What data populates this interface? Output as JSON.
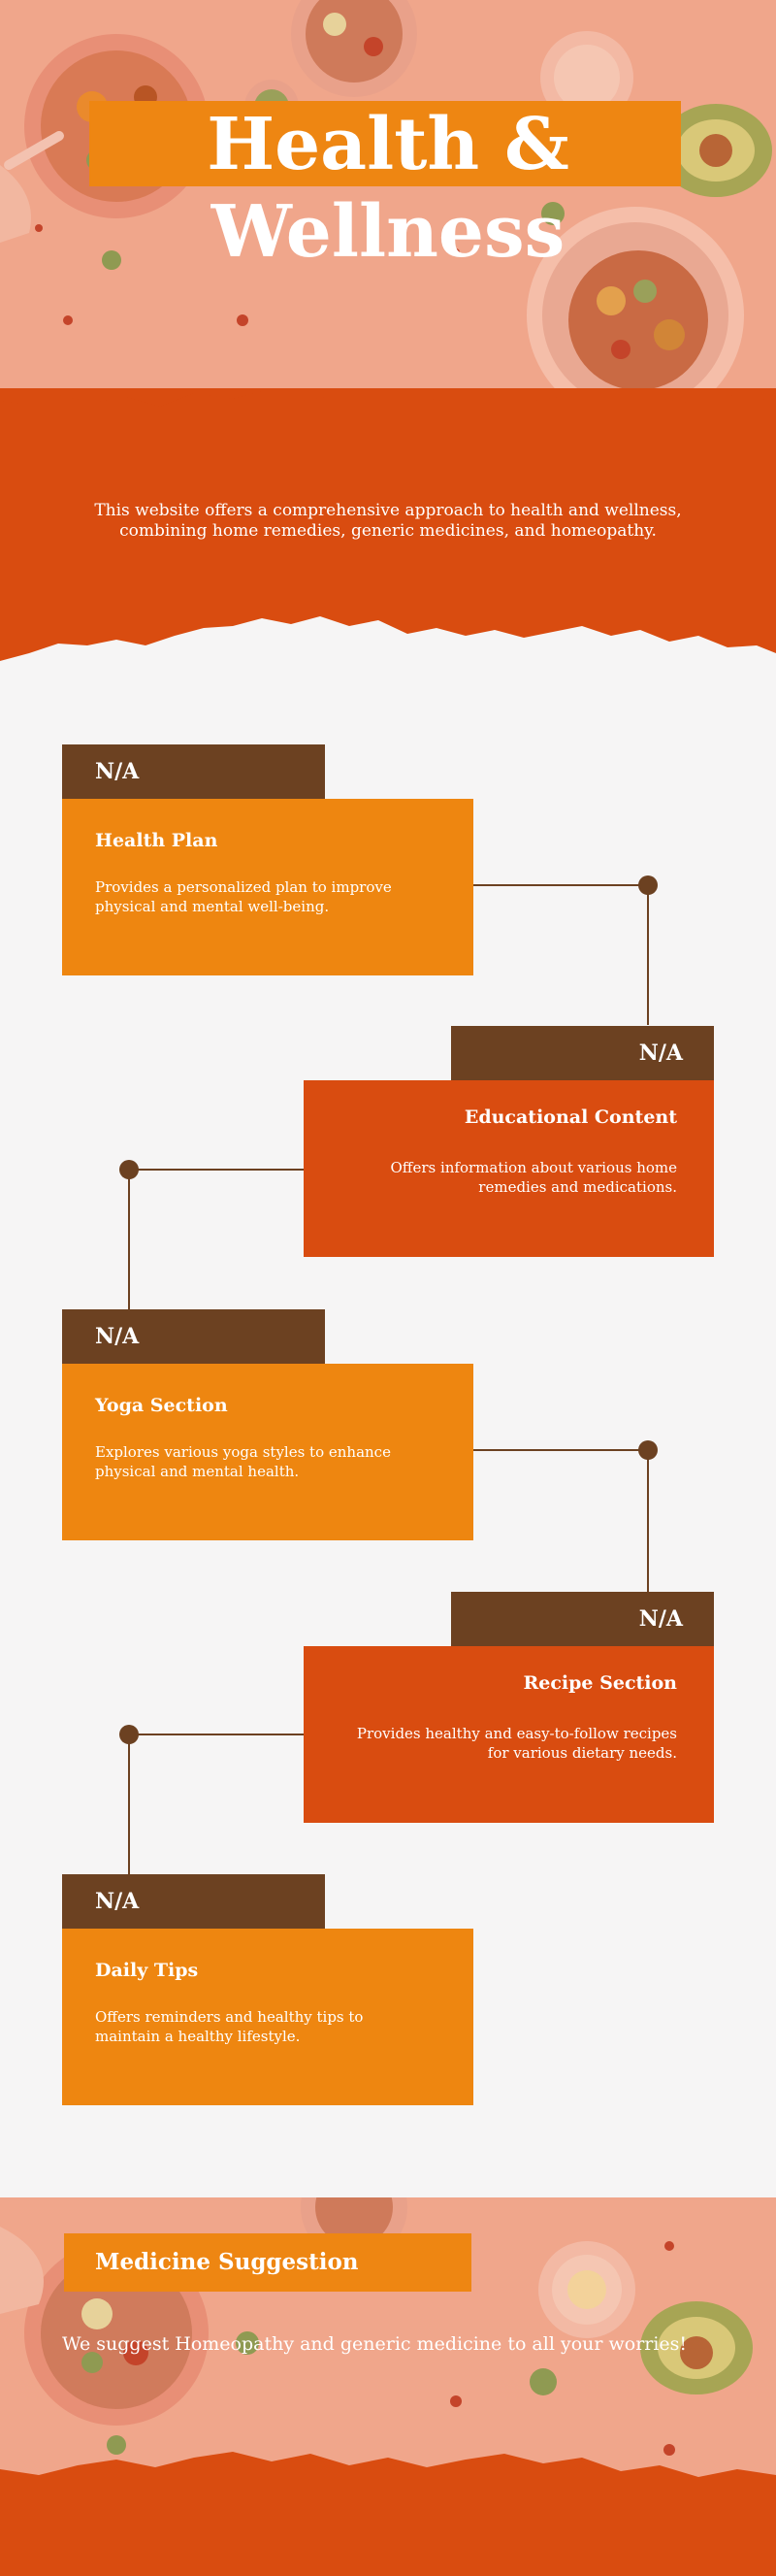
{
  "header": {
    "title_line1": "Health &",
    "title_line2": "Wellness",
    "description_line1": "This website offers a comprehensive approach to health and wellness,",
    "description_line2": "combining home remedies, generic medicines, and homeopathy."
  },
  "features": [
    {
      "tag": "N/A",
      "title": "Health Plan",
      "line1": "Provides a personalized plan to improve",
      "line2": "physical and mental well-being."
    },
    {
      "tag": "N/A",
      "title": "Educational Content",
      "line1": "Offers information about various home",
      "line2": "remedies and medications."
    },
    {
      "tag": "N/A",
      "title": "Yoga Section",
      "line1": "Explores various yoga styles to enhance",
      "line2": "physical and mental health."
    },
    {
      "tag": "N/A",
      "title": "Recipe Section",
      "line1": "Provides healthy and easy-to-follow recipes",
      "line2": "for various dietary needs."
    },
    {
      "tag": "N/A",
      "title": "Daily Tips",
      "line1": "Offers reminders and healthy tips to",
      "line2": "maintain a healthy lifestyle."
    }
  ],
  "footer": {
    "title": "Medicine Suggestion",
    "text": "We suggest Homeopathy and generic medicine to all your worries!"
  },
  "colors": {
    "deep_orange": "#d94c10",
    "orange": "#ee8610",
    "brown": "#6c4121",
    "background": "#f6f5f5",
    "peach_overlay": "#f0a68b"
  }
}
